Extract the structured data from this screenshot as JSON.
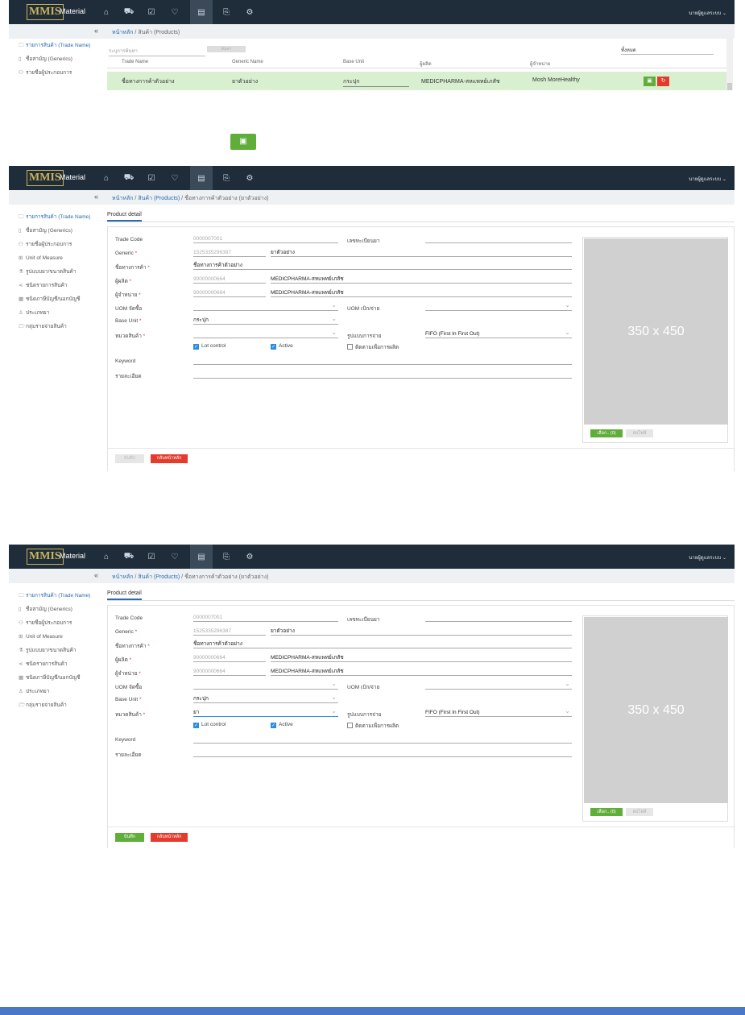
{
  "nav": {
    "brand": "Material",
    "logo": "MMIS",
    "user": "นายผู้ดูแลระบบ ⌄",
    "icons": [
      "home-icon",
      "cart-icon",
      "checklist-icon",
      "heart-icon",
      "database-icon",
      "document-icon",
      "settings-icon"
    ]
  },
  "grid_screen": {
    "crumb_home": "หน้าหลัก",
    "crumb_sep": "/",
    "crumb_products": "สินค้า (Products)",
    "search_placeholder": "ระบุการค้นหา",
    "search_btn": "ค้นหา",
    "filter": "ทั้งหมด",
    "cols": [
      "Trade Name",
      "Generic Name",
      "Base Unit",
      "ผู้ผลิต",
      "ผู้จำหน่าย"
    ],
    "row": {
      "trade": "ชื่อทางการค้าตัวอย่าง",
      "generic": "ยาตัวอย่าง",
      "unit": "กระปุก",
      "maker": "MEDICPHARMA-สหแพทย์เภสัช",
      "vendor": "Mosh MoreHealthy"
    },
    "side": [
      "รายการสินค้า (Trade Name)",
      "ชื่อสามัญ (Generics)",
      "รายชื่อผู้ประกอบการ",
      "Unit of Measure"
    ]
  },
  "save_icon": "💾",
  "form_common": {
    "crumb_home": "หน้าหลัก",
    "crumb_products": "สินค้า (Products)",
    "crumb_item": "ชื่อทางการค้าตัวอย่าง (ยาตัวอย่าง)",
    "tab": "Product detail",
    "side": [
      "รายการสินค้า (Trade Name)",
      "ชื่อสามัญ (Generics)",
      "รายชื่อผู้ประกอบการ",
      "Unit of Measure",
      "รูปแบบยา/ขนาดสินค้า",
      "ชนิดรายการสินค้า",
      "ชนิดภาษีบัญชี/นอกบัญชี",
      "ประเภทยา",
      "กลุ่มรายจ่ายสินค้า"
    ],
    "labels": {
      "trade_code": "Trade Code",
      "reg_no": "เลขทะเบียนยา",
      "generic": "Generic",
      "trade_name": "ชื่อทางการค้า",
      "maker": "ผู้ผลิต",
      "vendor": "ผู้จำหน่าย",
      "uom_buy": "UOM จัดซื้อ",
      "uom_issue": "UOM เบิก/จ่าย",
      "base_unit": "Base Unit",
      "category": "หมวดสินค้า",
      "issue_method": "รูปแบบการจ่าย",
      "keyword": "Keyword",
      "detail": "รายละเอียด"
    },
    "req": "*",
    "values": {
      "trade_code": "0000007001",
      "generic_code": "1525335296387",
      "generic_name": "ยาตัวอย่าง",
      "trade_name": "ชื่อทางการค้าตัวอย่าง",
      "maker_code": "90000000664",
      "maker_name": "MEDICPHARMA-สหแพทย์เภสัช",
      "vendor_code": "90000000664",
      "vendor_name": "MEDICPHARMA-สหแพทย์เภสัช",
      "base_unit": "กระปุก",
      "issue_method": "FIFO (First In First Out)"
    },
    "checks": {
      "lot": "Lot control",
      "active": "Active",
      "track": "ติดตามเพื่อการผลิต"
    },
    "image": {
      "placeholder": "350 x 450",
      "choose": "เลือก.. (0)",
      "remove": "ลบไฟล์"
    },
    "buttons": {
      "save": "บันทึก",
      "back": "กลับหน้าหลัก"
    }
  },
  "form2_category": "ยา"
}
